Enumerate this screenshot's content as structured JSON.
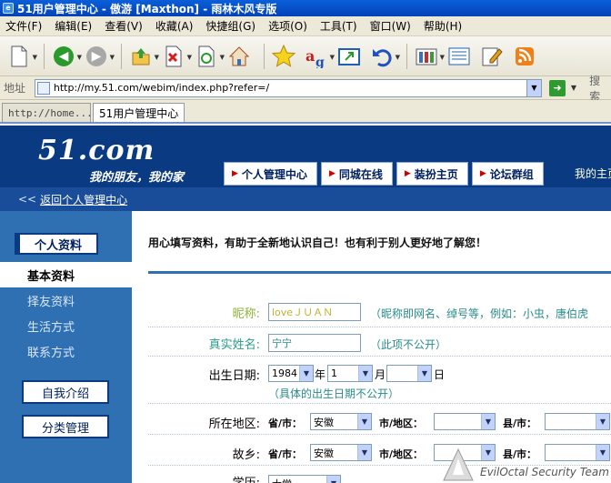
{
  "window": {
    "title": "51用户管理中心 - 傲游 [Maxthon] - 雨林木风专版"
  },
  "menu": [
    "文件(F)",
    "编辑(E)",
    "查看(V)",
    "收藏(A)",
    "快捷组(G)",
    "选项(O)",
    "工具(T)",
    "窗口(W)",
    "帮助(H)"
  ],
  "address": {
    "label": "地址",
    "url": "http://my.51.com/webim/index.php?refer=/",
    "search_label": "搜索"
  },
  "tabs": [
    {
      "label": "http://home...."
    },
    {
      "label": "51用户管理中心"
    }
  ],
  "site": {
    "logo": "51.com",
    "slogan": "我的朋友，我的家",
    "nav": [
      "个人管理中心",
      "同城在线",
      "装扮主页",
      "论坛群组"
    ],
    "nav_extra": "我的主页",
    "breadcrumb_icon": "<<",
    "breadcrumb": "返回个人管理中心"
  },
  "sidebar": {
    "heading": "个人资料",
    "items": [
      "基本资料",
      "择友资料",
      "生活方式",
      "联系方式"
    ],
    "buttons": [
      "自我介绍",
      "分类管理"
    ]
  },
  "main": {
    "intro": "用心填写资料，有助于全新地认识自己！也有利于别人更好地了解您！",
    "nickname": {
      "label": "昵称:",
      "value": "loveＪＵＡＮ",
      "hint": "（昵称即网名、绰号等，例如：小虫，唐伯虎"
    },
    "realname": {
      "label": "真实姓名:",
      "value": "宁宁",
      "hint": "（此项不公开）"
    },
    "birthday": {
      "label": "出生日期:",
      "year": "1984",
      "year_unit": "年",
      "month": "1",
      "month_unit": "月",
      "day": "",
      "day_unit": "日",
      "hint": "（具体的出生日期不公开）"
    },
    "location": {
      "label": "所在地区:",
      "province_label": "省/市：",
      "province": "安徽",
      "city_label": "市/地区：",
      "city": "",
      "county_label": "县/市：",
      "county": ""
    },
    "hometown": {
      "label": "故乡:",
      "province_label": "省/市：",
      "province": "安徽",
      "city_label": "市/地区：",
      "city": "",
      "county_label": "县/市：",
      "county": ""
    },
    "education": {
      "label": "学历:",
      "value": "大学"
    }
  },
  "watermark": "EvilOctal Security Team"
}
